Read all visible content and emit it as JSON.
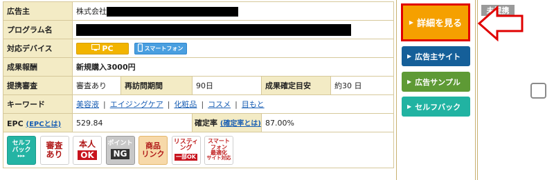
{
  "labels": {
    "advertiser": "広告主",
    "program_name": "プログラム名",
    "devices": "対応デバイス",
    "reward": "成果報酬",
    "review": "提携審査",
    "revisit_period": "再訪問期間",
    "confirm_time": "成果確定目安",
    "keywords": "キーワード",
    "epc": "EPC",
    "confirm_rate": "確定率"
  },
  "values": {
    "advertiser_prefix": "株式会社",
    "reward": "新規購入3000円",
    "review": "審査あり",
    "revisit_period": "90日",
    "confirm_time": "約30 日",
    "epc": "529.84",
    "confirm_rate": "87.00%"
  },
  "links": {
    "epc_help": "(EPCとは)",
    "confirm_rate_help": "(確定率とは)"
  },
  "devices": {
    "pc": "PC",
    "smartphone": "スマートフォン"
  },
  "keywords": [
    "美容液",
    "エイジングケア",
    "化粧品",
    "コスメ",
    "目もと"
  ],
  "keyword_separator": "|",
  "badges": {
    "self": {
      "lines": [
        "セルフ",
        "バック"
      ],
      "sub": "▸▸▸"
    },
    "review": {
      "lines": [
        "審査",
        "あり"
      ]
    },
    "honin": {
      "top": "本人",
      "box": "OK"
    },
    "point": {
      "top": "ポイント",
      "box": "NG"
    },
    "shohin": {
      "lines": [
        "商品",
        "リンク"
      ]
    },
    "listing": {
      "top": "リスティ",
      "mid": "ング",
      "box": "一部OK"
    },
    "smart": {
      "lines": [
        "スマート",
        "フォン",
        "最適化",
        "サイト対応"
      ]
    }
  },
  "buttons": {
    "detail": "詳細を見る",
    "advertiser_site": "広告主サイト",
    "ad_sample": "広告サンプル",
    "self_back": "セルフバック"
  },
  "status_tag": "未提携",
  "colors": {
    "label_bg": "#f3ebc5",
    "detail_button": "#f5a000",
    "highlight_border": "#e00000",
    "advertiser_site_button": "#155f99",
    "ad_sample_button": "#5e9a35",
    "self_back_button": "#21b3a2",
    "link": "#1a5fb4"
  },
  "icons": [
    "monitor-icon",
    "smartphone-icon",
    "right-triangle-icon",
    "red-arrow-icon"
  ]
}
